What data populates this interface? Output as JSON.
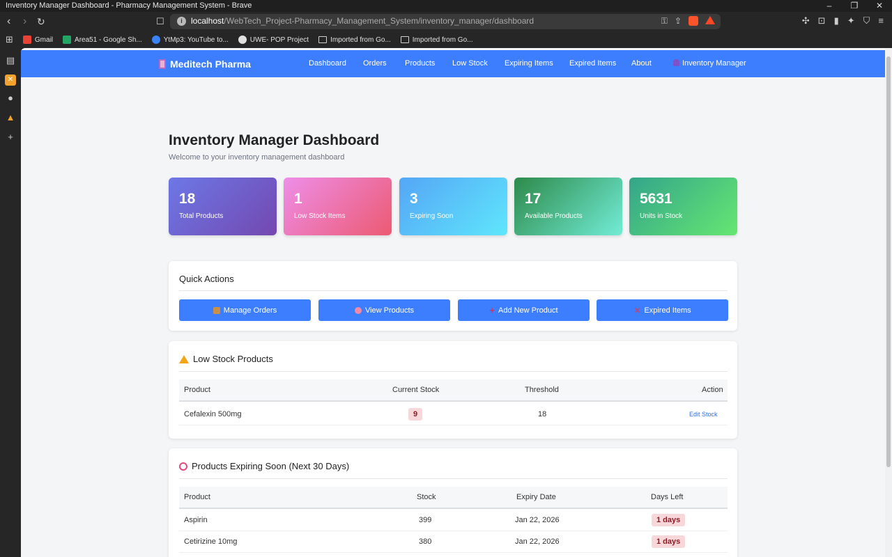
{
  "window": {
    "title": "Inventory Manager Dashboard - Pharmacy Management System - Brave",
    "controls": [
      "–",
      "❐",
      "✕"
    ]
  },
  "browser": {
    "url_host": "localhost",
    "url_path": "/WebTech_Project-Pharmacy_Management_System/inventory_manager/dashboard",
    "bookmarks": [
      {
        "label": "Gmail",
        "icon": "gmail-icon",
        "color": "#ea4335"
      },
      {
        "label": "Area51 - Google Sh...",
        "icon": "sheets-icon",
        "color": "#23a566"
      },
      {
        "label": "YtMp3: YouTube to...",
        "icon": "ytmp3-icon",
        "color": "#3b82f6"
      },
      {
        "label": "UWE- POP Project",
        "icon": "github-icon",
        "color": "#e0e0e0"
      },
      {
        "label": "Imported from Go...",
        "icon": "folder-icon",
        "color": ""
      },
      {
        "label": "Imported from Go...",
        "icon": "folder-icon",
        "color": ""
      }
    ]
  },
  "app": {
    "brand": "Meditech Pharma",
    "accent": "#3d7eff",
    "nav": [
      "Dashboard",
      "Orders",
      "Products",
      "Low Stock",
      "Expiring Items",
      "Expired Items",
      "About"
    ],
    "user": "Inventory Manager"
  },
  "header": {
    "title": "Inventory Manager Dashboard",
    "subtitle": "Welcome to your inventory management dashboard"
  },
  "stats": [
    {
      "value": "18",
      "label": "Total Products"
    },
    {
      "value": "1",
      "label": "Low Stock Items"
    },
    {
      "value": "3",
      "label": "Expiring Soon"
    },
    {
      "value": "17",
      "label": "Available Products"
    },
    {
      "value": "5631",
      "label": "Units in Stock"
    }
  ],
  "quick_actions": {
    "title": "Quick Actions",
    "buttons": [
      {
        "label": "Manage Orders",
        "icon": "package-icon"
      },
      {
        "label": "View Products",
        "icon": "pill-icon"
      },
      {
        "label": "Add New Product",
        "icon": "plus-icon"
      },
      {
        "label": "Expired Items",
        "icon": "cross-icon"
      }
    ]
  },
  "low_stock": {
    "title": "Low Stock Products",
    "headers": [
      "Product",
      "Current Stock",
      "Threshold",
      "Action"
    ],
    "rows": [
      {
        "product": "Cefalexin 500mg",
        "stock": "9",
        "threshold": "18",
        "action": "Edit Stock"
      }
    ]
  },
  "expiring": {
    "title": "Products Expiring Soon (Next 30 Days)",
    "headers": [
      "Product",
      "Stock",
      "Expiry Date",
      "Days Left"
    ],
    "rows": [
      {
        "product": "Aspirin",
        "stock": "399",
        "expiry": "Jan 22, 2026",
        "days": "1 days"
      },
      {
        "product": "Cetirizine 10mg",
        "stock": "380",
        "expiry": "Jan 22, 2026",
        "days": "1 days"
      }
    ]
  }
}
